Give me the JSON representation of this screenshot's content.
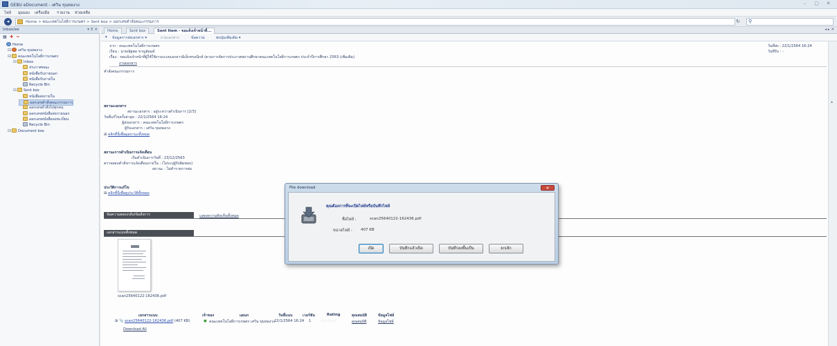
{
  "window": {
    "title": "GEBU eDocument - เศวิน ขุนทองวง",
    "controls": [
      "–",
      "▢",
      "✕"
    ]
  },
  "menu": [
    "ไฟล์",
    "มุมมอง",
    "เครื่องมือ",
    "รายงาน",
    "ช่วยเหลือ"
  ],
  "address": {
    "path": "Home > คณะเทคโนโลยีการเกษตร > Sent box > ออกเลขคำสั่งคณะกรรมการ",
    "search_placeholder": ""
  },
  "sidebar": {
    "title": "Inbox/ee",
    "controls": "▾ ⊼ ✕",
    "items": [
      {
        "label": "Home",
        "icon": "home-icon",
        "indent": 0
      },
      {
        "label": "เศวิน ขุนทองวง",
        "icon": "user-icon",
        "indent": 1
      },
      {
        "label": "คณะเทคโนโลยีการเกษตร",
        "icon": "folder-icon",
        "indent": 1
      },
      {
        "label": "Inbox",
        "icon": "folder-icon",
        "indent": 2
      },
      {
        "label": "ประกาศคณะ",
        "icon": "folder-icon",
        "indent": 3
      },
      {
        "label": "หนังสือรับภายนอก",
        "icon": "folder-icon",
        "indent": 3
      },
      {
        "label": "หนังสือรับภายใน",
        "icon": "folder-icon",
        "indent": 3
      },
      {
        "label": "Recycle Bin",
        "icon": "recycle-bin-icon",
        "indent": 3
      },
      {
        "label": "Sent box",
        "icon": "folder-icon",
        "indent": 2
      },
      {
        "label": "หนังสือส่งภายใน",
        "icon": "folder-icon",
        "indent": 3
      },
      {
        "label": "ออกเลขคำสั่งคณะกรรมการ",
        "icon": "folder-icon",
        "indent": 3
      },
      {
        "label": "ออกเลขคำสั่งไปทุกคน",
        "icon": "folder-icon",
        "indent": 3
      },
      {
        "label": "ออกเลขหนังสือส่งภายนอก",
        "icon": "folder-icon",
        "indent": 3
      },
      {
        "label": "ออกเลขหนังสือลงทะเบียน",
        "icon": "folder-icon",
        "indent": 3
      },
      {
        "label": "Recycle Bin",
        "icon": "recycle-bin-icon",
        "indent": 3
      },
      {
        "label": "Document box",
        "icon": "folder-icon",
        "indent": 1
      }
    ],
    "selected_index": 10
  },
  "tabs": [
    {
      "label": "Home",
      "active": false
    },
    {
      "label": "Sent box",
      "active": false
    },
    {
      "label": "Sent Item - ขอแจ้งเจ้าหน้าที่...",
      "active": true
    }
  ],
  "tab_scroll": "◂ ▸ ✕",
  "doc_toolbar": [
    "ข้อมูลการส่งเอกสาร ▾",
    "ถามเอกสาร",
    "ข้อความ",
    "พบปุ่มเพิ่มเติม ▾"
  ],
  "document": {
    "header_lines": [
      "จาก : คณะเทคโนโลยีการเกษตร",
      "เรียน : นายณัฐพล ขาญอ้อมค์",
      "เรื่อง : ขอแจ้งเจ้าหน้าที่ผู้ใช้ใช้งานระบบเอกสารอิเล็กทรอนิกส์ (ตามการจัดการประกาศสถานศึกษาคณะเทคโนโลยีการเกษตร ประจำปีการศึกษา 2563 (เพิ่มเติม)"
    ],
    "date_label": "วันที่ส่ง : 22/1/2564 16:24",
    "date_label_2": "วันที่รับ : -",
    "section_doc": "งานเอกสาร",
    "sub_note": "คำสั่งคณะกรรมการ",
    "status_title": "สถานะเอกสาร",
    "status_lines": [
      "สถานะเอกสาร : อยู่ระหว่างดำเนินการ [2/3]",
      "วันที่แก้ไขครั้งล่าสุด : 22/1/2564 16:24",
      "ผู้ส่งเอกสาร : คณะเทคโนโลยีการเกษตร",
      "ผู้รับเอกสาร : เศวิน ขุนทองวง"
    ],
    "status_link": "คลิกที่นี่เพื่อดูสถานะทั้งหมด",
    "proc_title": "สถานะการดำเนินการแจ้งเตือน",
    "proc_lines": [
      "เริ่มดำเนินการวันที่ : 23/12/2563",
      "ตรวจสอบคำสั่งการแจ้งเตือนภายใน : (ไม่ระบุผู้รับผิดชอบ)",
      "สถานะ : ไม่ทำรายการต่อ"
    ],
    "history_title": "ประวัติการแก้ไข",
    "history_link": "คลิกที่นี่เพื่อดูประวัติทั้งหมด",
    "bar1_left": "ข้อความตอบกลับ/ข้อสั่งการ",
    "bar1_right": "แสดงความคิดเห็นทั้งหมด",
    "bar2": "เอกสารแนบทั้งหมด",
    "thumb_caption": "scan25640122-162436.pdf"
  },
  "dialog": {
    "title": "File download",
    "close": "✕",
    "question": "คุณต้องการที่จะเปิดไฟล์หรือบันทึกไฟล์",
    "name_label": "ชื่อไฟล์ :",
    "name_value": "scan25640122-162436.pdf",
    "size_label": "ขนาดไฟล์ :",
    "size_value": "407 KB",
    "buttons": [
      "เปิด",
      "บันทึกแล้วเปิด",
      "บันทึกลงพื้นเป็น",
      "ยกเลิก"
    ]
  },
  "file_table": {
    "headers": [
      "เอกสารแนบ",
      "เจ้าของ",
      "แผนก",
      "วันที่แนบ",
      "เวอร์ชัน",
      "Rating",
      "คุณสมบัติ",
      "ข้อมูลไฟล์"
    ],
    "row": {
      "name": "scan25640122-162436.pdf",
      "size": "(407 KB)",
      "owner": "คณะเทคโนโลยีการเกษตร เศวิน ขุนทองวง",
      "date": "22/1/2564 16:24",
      "version": "1",
      "rating": "☆☆☆☆☆",
      "props": "คุณสมบัติ",
      "info": "ข้อมูลไฟล์"
    },
    "download_all": "Download All"
  }
}
